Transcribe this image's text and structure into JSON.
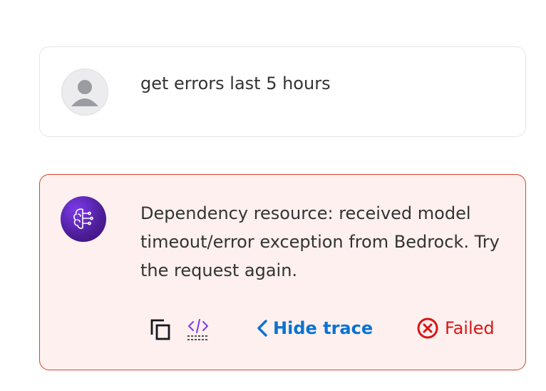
{
  "user_message": {
    "avatar_icon": "user-avatar-icon",
    "text": "get errors last 5 hours"
  },
  "assistant_message": {
    "avatar_icon": "ai-brain-icon",
    "text": "Dependency resource: received model timeout/error exception from Bedrock. Try the request again.",
    "toolbar": {
      "copy_icon": "copy-icon",
      "code_icon": "code-icon",
      "hide_trace_label": "Hide trace",
      "status_label": "Failed"
    }
  },
  "colors": {
    "error_border": "#d8432e",
    "error_background": "#fdf0ee",
    "link_blue": "#0972d3",
    "error_red": "#d91515",
    "ai_avatar_purple": "#5b21b6"
  }
}
